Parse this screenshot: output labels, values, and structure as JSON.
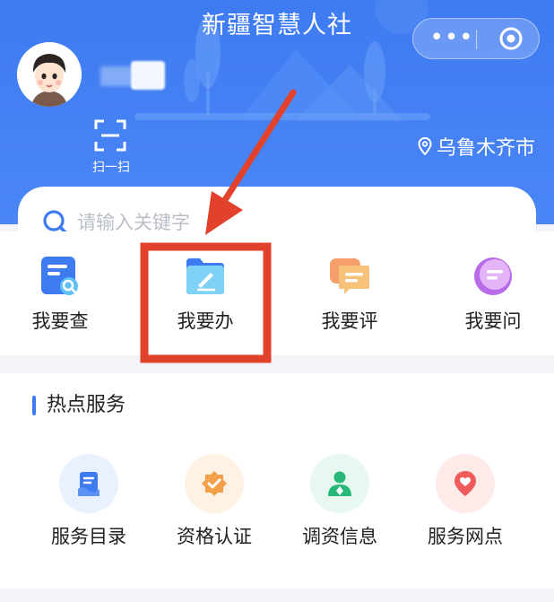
{
  "header": {
    "title": "新疆智慧人社",
    "more_glyph": "•••",
    "scan_label": "扫一扫",
    "location": "乌鲁木齐市",
    "bg_color": "#3e7bf1"
  },
  "search": {
    "placeholder": "请输入关键字"
  },
  "features": [
    {
      "label": "我要查",
      "icon": "doc-search-icon"
    },
    {
      "label": "我要办",
      "icon": "folder-edit-icon"
    },
    {
      "label": "我要评",
      "icon": "chat-comment-icon"
    },
    {
      "label": "我要问",
      "icon": "question-bubble-icon"
    }
  ],
  "hot": {
    "title": "热点服务",
    "items": [
      {
        "label": "服务目录",
        "icon": "catalog-icon",
        "bg": "#e9f1ff"
      },
      {
        "label": "资格认证",
        "icon": "certification-badge-icon",
        "bg": "#fff1e3"
      },
      {
        "label": "调资信息",
        "icon": "person-salary-icon",
        "bg": "#e6f8ef"
      },
      {
        "label": "服务网点",
        "icon": "location-heart-icon",
        "bg": "#ffeaea"
      }
    ]
  },
  "annotation": {
    "color": "#e2422b",
    "highlighted": "我要办"
  }
}
